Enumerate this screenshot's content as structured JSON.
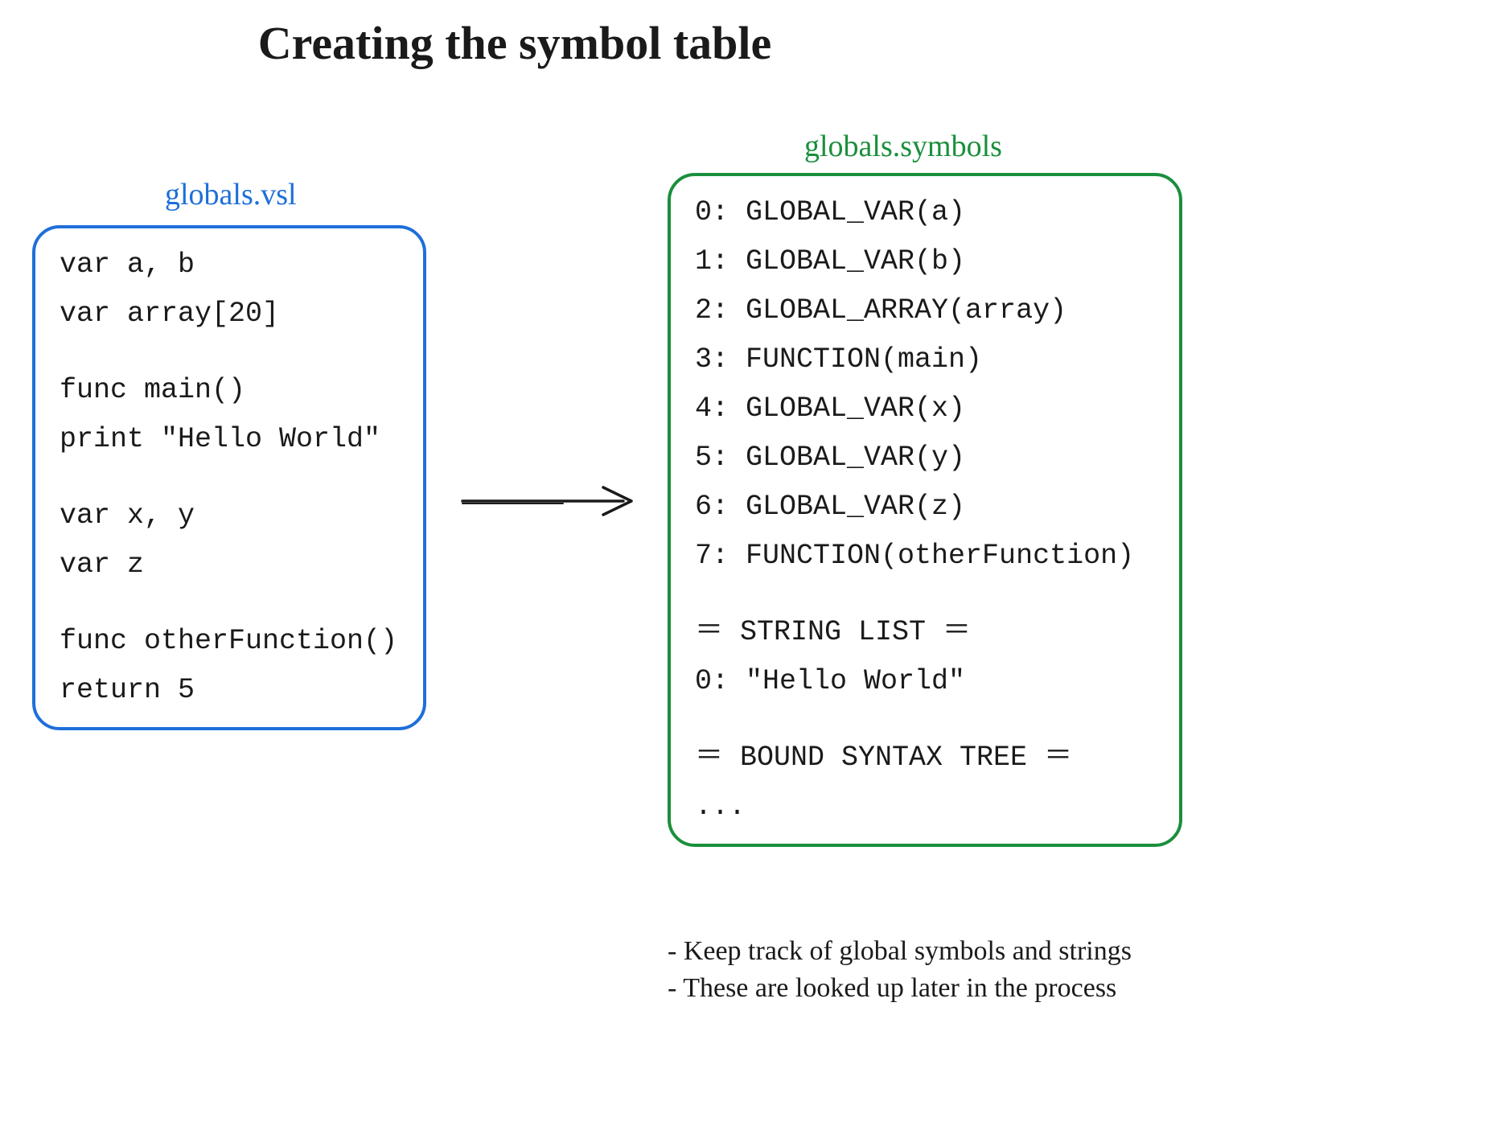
{
  "title": "Creating the symbol table",
  "left": {
    "label": "globals.vsl",
    "lines": [
      "var a, b",
      "var array[20]",
      "",
      "func main()",
      "print \"Hello World\"",
      "",
      "var x, y",
      "var z",
      "",
      "func otherFunction()",
      "return 5"
    ]
  },
  "right": {
    "label": "globals.symbols",
    "lines": [
      "0: GLOBAL_VAR(a)",
      "1: GLOBAL_VAR(b)",
      "2: GLOBAL_ARRAY(array)",
      "3: FUNCTION(main)",
      "4: GLOBAL_VAR(x)",
      "5: GLOBAL_VAR(y)",
      "6: GLOBAL_VAR(z)",
      "7: FUNCTION(otherFunction)",
      "",
      "＝ STRING LIST ＝",
      "0: \"Hello World\"",
      "",
      "＝ BOUND SYNTAX TREE ＝",
      "..."
    ]
  },
  "notes": [
    "- Keep track of global symbols and strings",
    "- These are looked up later in the process"
  ]
}
